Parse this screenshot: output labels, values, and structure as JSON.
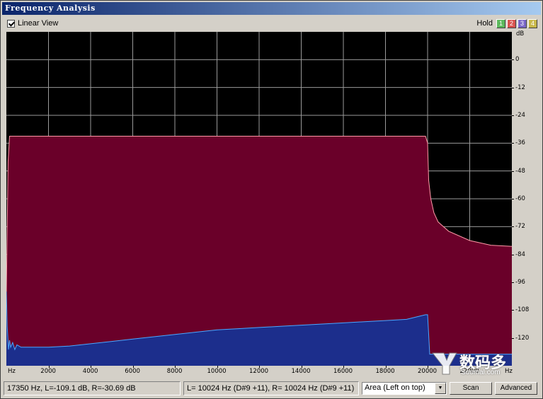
{
  "window": {
    "title": "Frequency Analysis",
    "close": "×"
  },
  "toolbar": {
    "linear_view_label": "Linear View",
    "linear_view_checked": true,
    "hold_label": "Hold",
    "hold_buttons": [
      {
        "label": "1",
        "color": "#5cb85c"
      },
      {
        "label": "2",
        "color": "#d9534f"
      },
      {
        "label": "3",
        "color": "#7b68c8"
      },
      {
        "label": "4",
        "color": "#c8b84a"
      }
    ]
  },
  "chart_data": {
    "type": "area",
    "x_unit_label": "Hz",
    "y_unit_label": "dB",
    "x_ticks": [
      2000,
      4000,
      6000,
      8000,
      10000,
      12000,
      14000,
      16000,
      18000,
      20000,
      22000
    ],
    "x_tick_labels": [
      "2000",
      "4000",
      "6000",
      "8000",
      "10000",
      "12000",
      "14000",
      "16000",
      "18000",
      "20000",
      "22000"
    ],
    "y_ticks": [
      0,
      -12,
      -24,
      -36,
      -48,
      -60,
      -72,
      -84,
      -96,
      -108,
      -120
    ],
    "y_tick_labels": [
      "0",
      "-12",
      "-24",
      "-36",
      "-48",
      "-60",
      "-72",
      "-84",
      "-96",
      "-108",
      "-120"
    ],
    "xlim": [
      0,
      24000
    ],
    "ylim": [
      -132,
      12
    ],
    "grid": true,
    "series": [
      {
        "color": "#6a0029",
        "line_color": "#ff9aa8",
        "x": [
          0,
          80,
          150,
          300,
          1000,
          5000,
          10000,
          15000,
          19900,
          20000,
          20050,
          20150,
          20300,
          20500,
          21000,
          22000,
          23000,
          24000
        ],
        "values": [
          -101,
          -44,
          -33,
          -33,
          -33,
          -33,
          -33,
          -33,
          -33,
          -36,
          -52,
          -60,
          -66,
          -70,
          -74,
          -78,
          -80,
          -80.5
        ]
      },
      {
        "color": "#1c2e8c",
        "line_color": "#4aa8ff",
        "x": [
          0,
          40,
          100,
          150,
          200,
          300,
          400,
          500,
          700,
          1000,
          1500,
          2000,
          3000,
          4000,
          5000,
          6000,
          7000,
          8000,
          9000,
          10000,
          11000,
          12000,
          13000,
          14000,
          15000,
          16000,
          17000,
          18000,
          19000,
          19900,
          20000,
          20100,
          21000,
          22000,
          23000,
          24000
        ],
        "values": [
          -100,
          -115,
          -125,
          -121,
          -124,
          -122,
          -125,
          -123,
          -124,
          -124,
          -124,
          -124,
          -123.5,
          -122.5,
          -121.5,
          -120.5,
          -119.5,
          -118.5,
          -117.5,
          -116.5,
          -116,
          -115.5,
          -115,
          -114.5,
          -114,
          -113.5,
          -113,
          -112.5,
          -112,
          -110,
          -110,
          -127,
          -127,
          -127,
          -127,
          -127
        ]
      }
    ]
  },
  "status": {
    "cursor_readout": "17350 Hz, L=-109.1 dB, R=-30.69 dB",
    "peak_readout": "L=  10024 Hz (D#9 +11), R=  10024 Hz (D#9 +11)",
    "view_mode": "Area (Left on top)",
    "scan_label": "Scan",
    "advanced_label": "Advanced"
  },
  "watermark": {
    "text": "数码多",
    "url": "Soomal.com"
  }
}
